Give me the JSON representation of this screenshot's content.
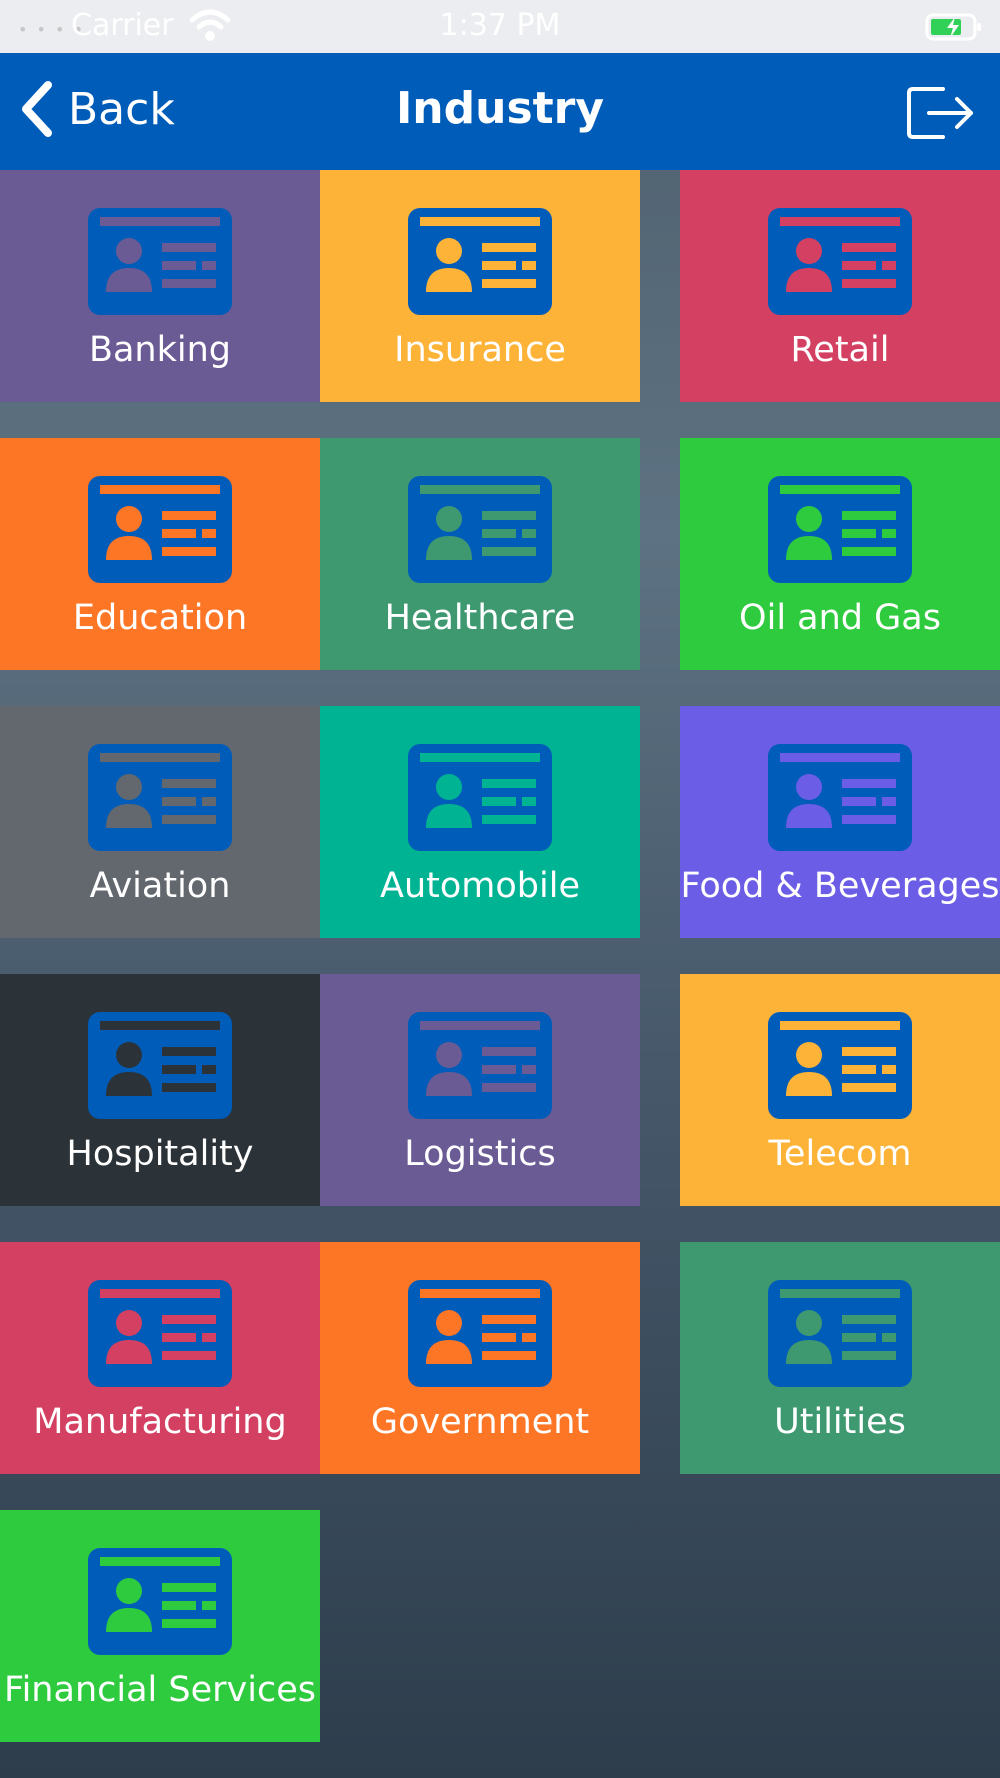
{
  "status_bar": {
    "signal": "• • • •",
    "carrier": "Carrier",
    "time": "1:37 PM",
    "wifi_icon": "wifi-icon",
    "battery_icon": "battery-charging-icon"
  },
  "nav": {
    "back_label": "Back",
    "title": "Industry",
    "back_icon": "chevron-left-icon",
    "logout_icon": "logout-icon"
  },
  "colors": {
    "nav_bar": "#005cb9",
    "card_icon": "#005cb9",
    "tile_text": "#ffffff"
  },
  "industries": [
    {
      "label": "Banking",
      "color": "#6a5b94",
      "icon": "id-card-icon"
    },
    {
      "label": "Insurance",
      "color": "#fdb337",
      "icon": "id-card-icon"
    },
    {
      "label": "Retail",
      "color": "#d44062",
      "icon": "id-card-icon"
    },
    {
      "label": "Education",
      "color": "#fd7626",
      "icon": "id-card-icon"
    },
    {
      "label": "Healthcare",
      "color": "#3e9970",
      "icon": "id-card-icon"
    },
    {
      "label": "Oil and Gas",
      "color": "#2fcb3f",
      "icon": "id-card-icon"
    },
    {
      "label": "Aviation",
      "color": "#62686e",
      "icon": "id-card-icon"
    },
    {
      "label": "Automobile",
      "color": "#00b493",
      "icon": "id-card-icon"
    },
    {
      "label": "Food & Beverages",
      "color": "#6b5de6",
      "icon": "id-card-icon"
    },
    {
      "label": "Hospitality",
      "color": "#2b3338",
      "icon": "id-card-icon"
    },
    {
      "label": "Logistics",
      "color": "#6a5b94",
      "icon": "id-card-icon"
    },
    {
      "label": "Telecom",
      "color": "#fdb337",
      "icon": "id-card-icon"
    },
    {
      "label": "Manufacturing",
      "color": "#d44062",
      "icon": "id-card-icon"
    },
    {
      "label": "Government",
      "color": "#fd7626",
      "icon": "id-card-icon"
    },
    {
      "label": "Utilities",
      "color": "#3e9970",
      "icon": "id-card-icon"
    },
    {
      "label": "Financial Services",
      "color": "#2fcb3f",
      "icon": "id-card-icon"
    }
  ]
}
